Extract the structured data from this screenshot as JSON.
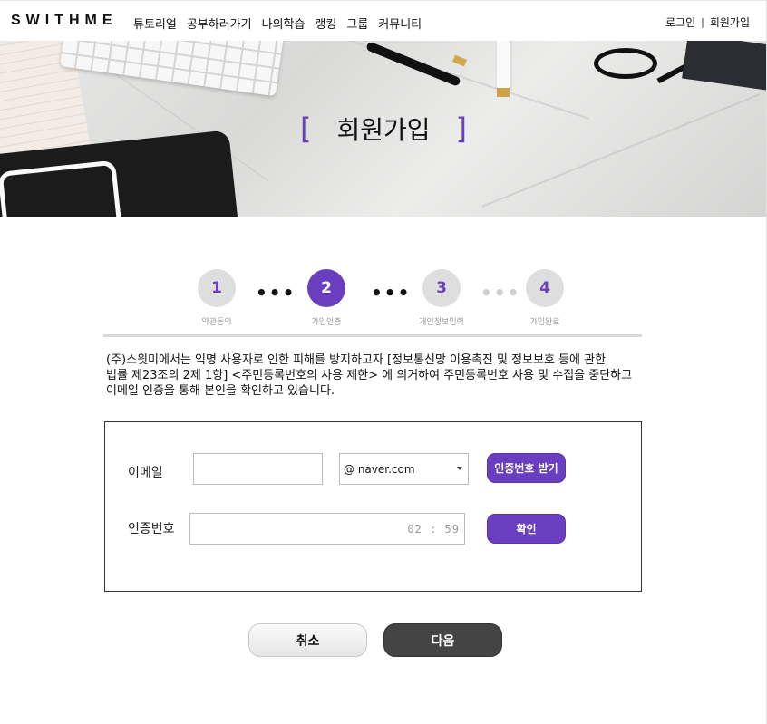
{
  "header": {
    "logo": "SWITHME",
    "nav": [
      "튜토리얼",
      "공부하러가기",
      "나의학습",
      "랭킹",
      "그룹",
      "커뮤니티"
    ],
    "login": "로그인",
    "separator": "|",
    "signup": "회원가입"
  },
  "hero": {
    "bracket_left": "[",
    "title": "회원가입",
    "bracket_right": "]"
  },
  "steps": {
    "items": [
      {
        "number": "1",
        "label": "약관동의"
      },
      {
        "number": "2",
        "label": "가입인증"
      },
      {
        "number": "3",
        "label": "개인정보입력"
      },
      {
        "number": "4",
        "label": "가입완료"
      }
    ],
    "active_step": 2,
    "dots": "•••"
  },
  "notice": {
    "line1": "(주)스윗미에서는 익명 사용자로 인한 피해를 방지하고자 [정보통신망 이용촉진 및 정보보호 등에 관한",
    "line2": "법률 제23조의 2제 1항] <주민등록번호의 사용 제한> 에 의거하여 주민등록번호 사용 및 수집을 중단하고",
    "line3": "이메일 인증을 통해 본인을 확인하고 있습니다."
  },
  "form": {
    "email_label": "이메일",
    "email_value": "",
    "domain_selected": "@ naver.com",
    "send_code_button": "인증번호 받기",
    "code_label": "인증번호",
    "code_value": "",
    "timer": "02 : 59",
    "confirm_button": "확인"
  },
  "actions": {
    "cancel": "취소",
    "next": "다음"
  },
  "colors": {
    "accent": "#6a3fbf",
    "dark_button": "#444444"
  }
}
